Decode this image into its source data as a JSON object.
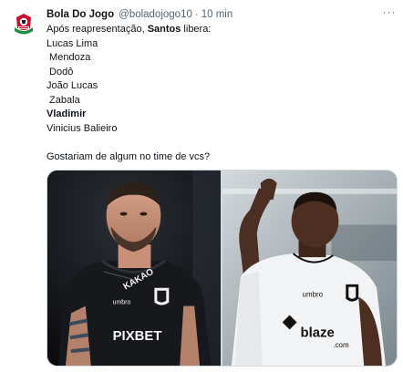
{
  "tweet": {
    "author_name": "Bola Do Jogo",
    "handle": "@boladojogo10",
    "separator": "·",
    "time": "10 min",
    "more_label": "···",
    "lines": [
      {
        "parts": [
          {
            "text": "Após reapresentação, ",
            "bold": false
          },
          {
            "text": "Santos",
            "bold": true
          },
          {
            "text": " libera:",
            "bold": false
          }
        ]
      },
      {
        "parts": [
          {
            "text": "Lucas Lima",
            "bold": false
          }
        ]
      },
      {
        "parts": [
          {
            "text": " Mendoza",
            "bold": false
          }
        ]
      },
      {
        "parts": [
          {
            "text": " Dodô",
            "bold": false
          }
        ]
      },
      {
        "parts": [
          {
            "text": "João Lucas",
            "bold": false
          }
        ]
      },
      {
        "parts": [
          {
            "text": " Zabala",
            "bold": false
          }
        ]
      },
      {
        "parts": [
          {
            "text": "Vladimir",
            "bold": true
          }
        ]
      },
      {
        "parts": [
          {
            "text": "Vinicius Balieiro",
            "bold": false
          }
        ]
      },
      {
        "parts": []
      },
      {
        "parts": [
          {
            "text": "Gostariam de algum no time de vcs?",
            "bold": false
          }
        ]
      }
    ]
  },
  "media": {
    "left_photo": {
      "sponsor_text": "PIXBET",
      "chest_text": "KAKAO",
      "sleeve_text": "umbro"
    },
    "right_photo": {
      "sponsor_text": "blaze",
      "sponsor_suffix": ".com",
      "chest_text": "umbro"
    }
  },
  "colors": {
    "text": "#0f1419",
    "secondary": "#536471",
    "border": "#cfd9de",
    "avatar_red": "#c8102e",
    "avatar_green": "#1a8f3c"
  }
}
